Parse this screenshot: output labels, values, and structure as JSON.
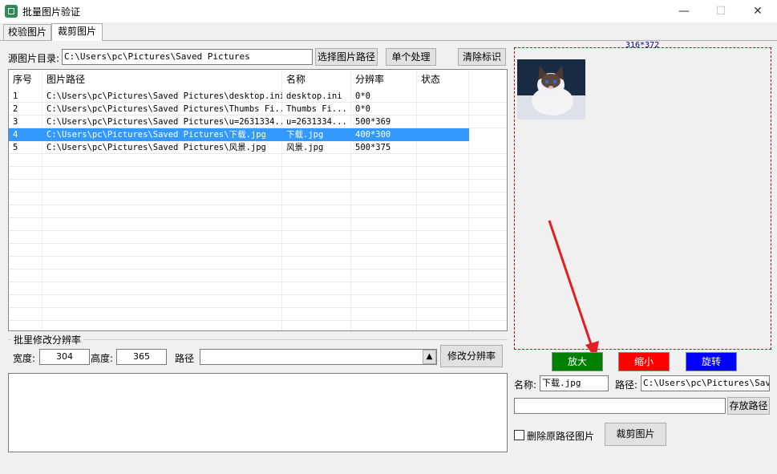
{
  "window": {
    "title": "批量图片验证",
    "minimize": "—",
    "maximize": "☐",
    "close": "✕"
  },
  "tabs": [
    {
      "label": "校验图片"
    },
    {
      "label": "裁剪图片"
    }
  ],
  "source": {
    "label": "源图片目录:",
    "path": "C:\\Users\\pc\\Pictures\\Saved Pictures",
    "choose_button": "选择图片路径",
    "single_button": "单个处理",
    "clear_button": "清除标识"
  },
  "table": {
    "headers": [
      "序号",
      "图片路径",
      "名称",
      "分辨率",
      "状态"
    ],
    "rows": [
      {
        "no": "1",
        "path": "C:\\Users\\pc\\Pictures\\Saved Pictures\\desktop.ini",
        "name": "desktop.ini",
        "res": "0*0",
        "status": ""
      },
      {
        "no": "2",
        "path": "C:\\Users\\pc\\Pictures\\Saved Pictures\\Thumbs Fi...",
        "name": "Thumbs Fi...",
        "res": "0*0",
        "status": ""
      },
      {
        "no": "3",
        "path": "C:\\Users\\pc\\Pictures\\Saved Pictures\\u=2631334...",
        "name": "u=2631334...",
        "res": "500*369",
        "status": ""
      },
      {
        "no": "4",
        "path": "C:\\Users\\pc\\Pictures\\Saved Pictures\\下载.jpg",
        "name": "下载.jpg",
        "res": "400*300",
        "status": ""
      },
      {
        "no": "5",
        "path": "C:\\Users\\pc\\Pictures\\Saved Pictures\\风景.jpg",
        "name": "风景.jpg",
        "res": "500*375",
        "status": ""
      }
    ]
  },
  "batch": {
    "legend": "批里修改分辨率",
    "width_label": "宽度:",
    "width_value": "304",
    "height_label": "高度:",
    "height_value": "365",
    "path_label": "路径",
    "path_value": "",
    "button": "修改分辨率"
  },
  "preview": {
    "size_label": "316*372"
  },
  "actions": {
    "zoom_in": "放大",
    "zoom_out": "缩小",
    "rotate": "旋转"
  },
  "colors": {
    "zoom_in": "#008000",
    "zoom_out": "#ff0000",
    "rotate": "#0000ff"
  },
  "output": {
    "name_label": "名称:",
    "name_value": "下载.jpg",
    "path_label": "路径:",
    "path_value": "C:\\Users\\pc\\Pictures\\Saved",
    "save_path_value": "",
    "save_path_button": "存放路径",
    "delete_label": "删除原路径图片",
    "crop_button": "裁剪图片"
  }
}
